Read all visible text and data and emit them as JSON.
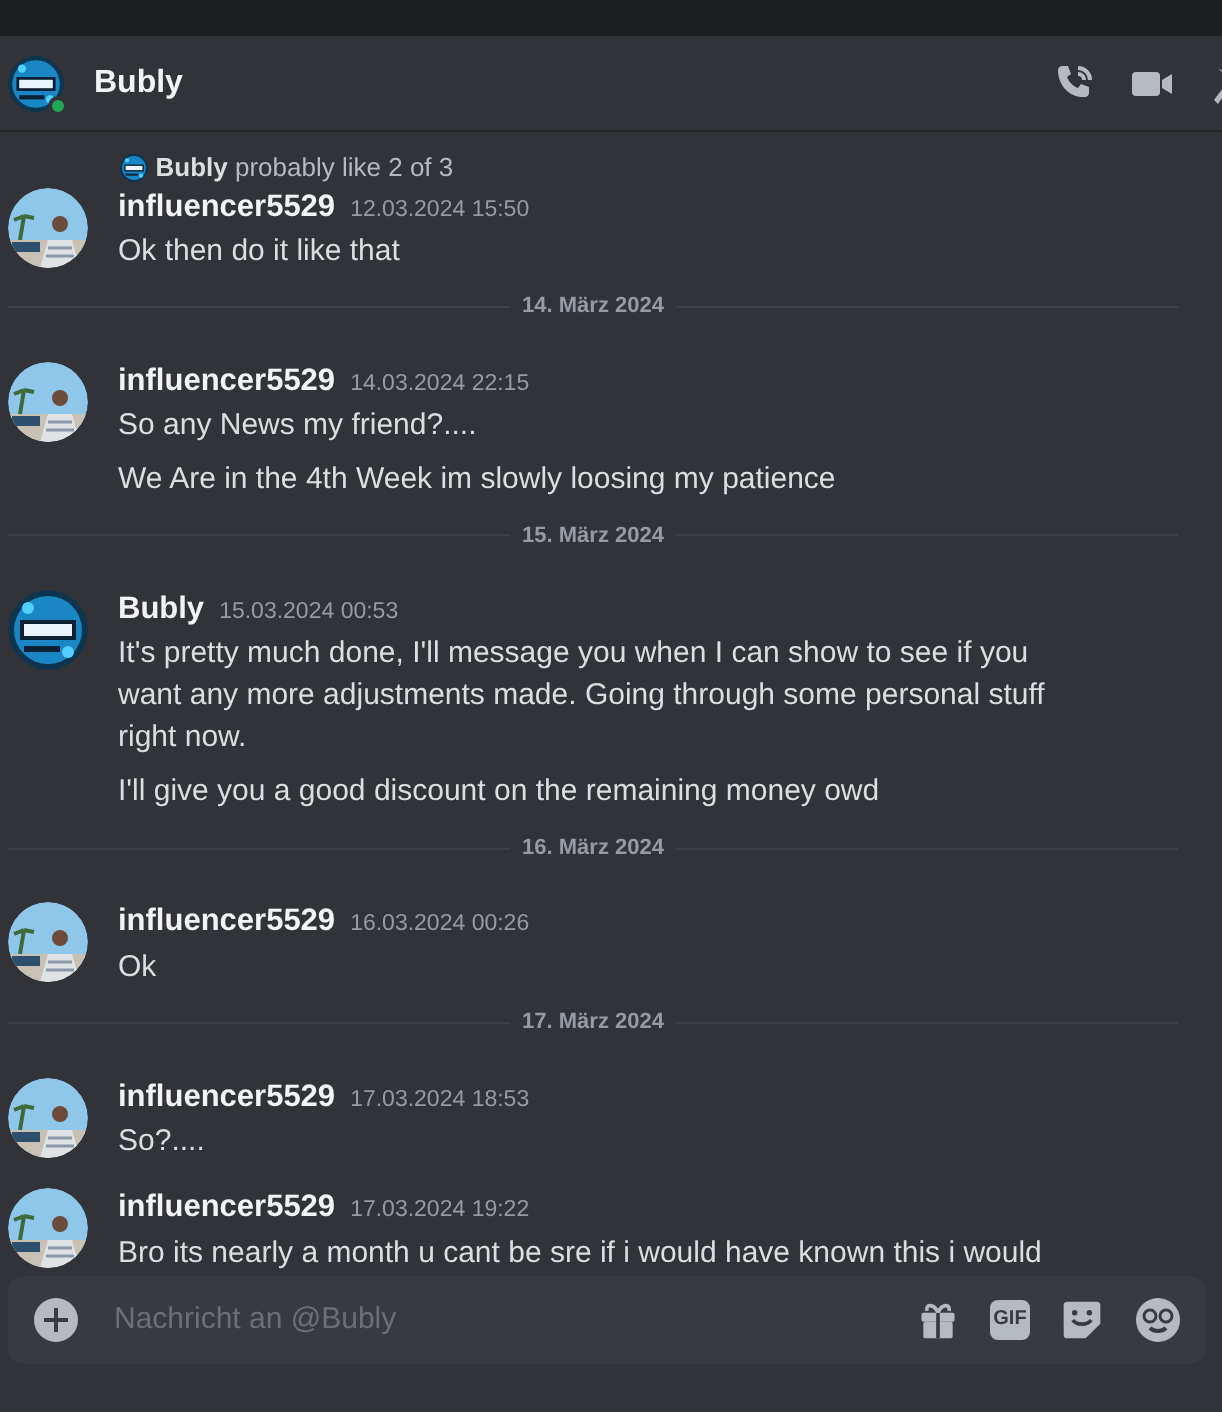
{
  "header": {
    "title": "Bubly",
    "online": true
  },
  "messages": [
    {
      "kind": "message",
      "logo_avatar": false,
      "author": "influencer5529",
      "time": "12.03.2024 15:50",
      "reply": {
        "author": "Bubly",
        "text": "probably like 2 of 3"
      },
      "paragraphs": [
        "Ok then do it like that"
      ]
    },
    {
      "kind": "divider",
      "label": "14. März 2024"
    },
    {
      "kind": "message",
      "logo_avatar": false,
      "author": "influencer5529",
      "time": "14.03.2024 22:15",
      "paragraphs": [
        "So any News my friend?....",
        "We Are in the 4th Week im slowly loosing my patience"
      ]
    },
    {
      "kind": "divider",
      "label": "15. März 2024"
    },
    {
      "kind": "message",
      "logo_avatar": true,
      "author": "Bubly",
      "time": "15.03.2024 00:53",
      "paragraphs": [
        "It's pretty much done, I'll message you when I can show to see if you want any more adjustments made. Going through some personal stuff right now.",
        "I'll give you a good discount on the remaining money owd"
      ]
    },
    {
      "kind": "divider",
      "label": "16. März 2024"
    },
    {
      "kind": "message",
      "logo_avatar": false,
      "author": "influencer5529",
      "time": "16.03.2024 00:26",
      "paragraphs": [
        "Ok"
      ]
    },
    {
      "kind": "divider",
      "label": "17. März 2024"
    },
    {
      "kind": "message",
      "logo_avatar": false,
      "author": "influencer5529",
      "time": "17.03.2024 18:53",
      "paragraphs": [
        "So?...."
      ]
    },
    {
      "kind": "message",
      "logo_avatar": false,
      "author": "influencer5529",
      "time": "17.03.2024 19:22",
      "paragraphs": [
        "Bro its nearly a month u cant be sre if i would have known this i would"
      ]
    }
  ],
  "composer": {
    "placeholder": "Nachricht an @Bubly",
    "gif_label": "GIF"
  }
}
